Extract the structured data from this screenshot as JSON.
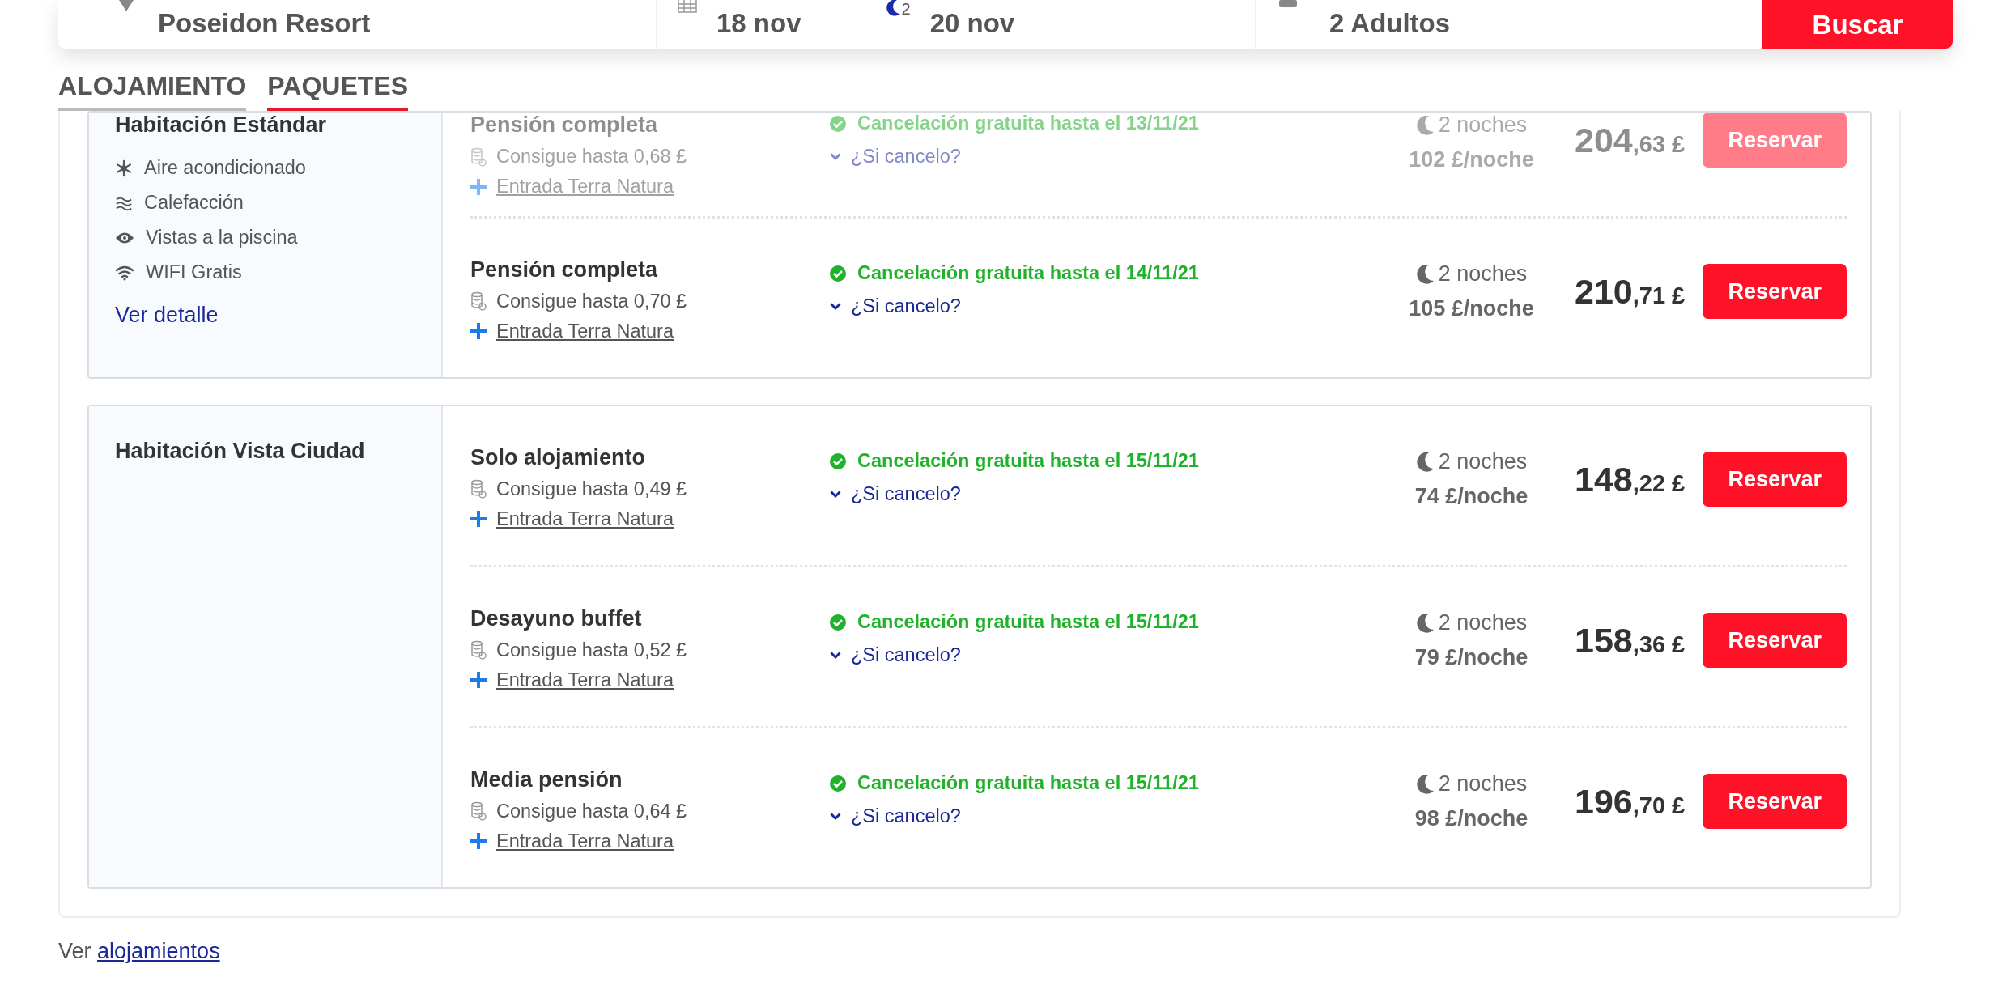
{
  "search": {
    "destination": "Poseidon Resort",
    "checkin": "18 nov",
    "nights": "2",
    "checkout": "20 nov",
    "guests": "2 Adultos",
    "button": "Buscar"
  },
  "tabs": [
    {
      "label": "ALOJAMIENTO",
      "selected": false
    },
    {
      "label": "PAQUETES",
      "selected": true
    }
  ],
  "rooms": [
    {
      "name": "Habitación Estándar",
      "amenities": [
        {
          "kind": "snowflake",
          "label": "Aire acondicionado"
        },
        {
          "kind": "waves",
          "label": "Calefacción"
        },
        {
          "kind": "eye",
          "label": "Vistas a la piscina"
        },
        {
          "kind": "wifi",
          "label": "WIFI Gratis"
        }
      ],
      "detail_link": "Ver detalle",
      "rates": [
        {
          "board": "Pensión completa",
          "points": "Consigue hasta 0,68 £",
          "extra": "Entrada Terra Natura",
          "cancellation": "Cancelación gratuita hasta el 13/11/21",
          "cancel_toggle": "¿Si cancelo?",
          "nights": "2 noches",
          "per_night": "102 £/noche",
          "price_int": "204",
          "price_dec": ",63 £",
          "button": "Reservar",
          "faded": true
        },
        {
          "board": "Pensión completa",
          "points": "Consigue hasta 0,70 £",
          "extra": "Entrada Terra Natura",
          "cancellation": "Cancelación gratuita hasta el 14/11/21",
          "cancel_toggle": "¿Si cancelo?",
          "nights": "2 noches",
          "per_night": "105 £/noche",
          "price_int": "210",
          "price_dec": ",71 £",
          "button": "Reservar",
          "faded": false
        }
      ]
    },
    {
      "name": "Habitación Vista Ciudad",
      "rates": [
        {
          "board": "Solo alojamiento",
          "points": "Consigue hasta 0,49 £",
          "extra": "Entrada Terra Natura",
          "cancellation": "Cancelación gratuita hasta el 15/11/21",
          "cancel_toggle": "¿Si cancelo?",
          "nights": "2 noches",
          "per_night": "74 £/noche",
          "price_int": "148",
          "price_dec": ",22 £",
          "button": "Reservar",
          "faded": false
        },
        {
          "board": "Desayuno buffet",
          "points": "Consigue hasta 0,52 £",
          "extra": "Entrada Terra Natura",
          "cancellation": "Cancelación gratuita hasta el 15/11/21",
          "cancel_toggle": "¿Si cancelo?",
          "nights": "2 noches",
          "per_night": "79 £/noche",
          "price_int": "158",
          "price_dec": ",36 £",
          "button": "Reservar",
          "faded": false
        },
        {
          "board": "Media pensión",
          "points": "Consigue hasta 0,64 £",
          "extra": "Entrada Terra Natura",
          "cancellation": "Cancelación gratuita hasta el 15/11/21",
          "cancel_toggle": "¿Si cancelo?",
          "nights": "2 noches",
          "per_night": "98 £/noche",
          "price_int": "196",
          "price_dec": ",70 £",
          "button": "Reservar",
          "faded": false
        }
      ]
    }
  ],
  "footer": {
    "prefix": "Ver",
    "link": "alojamientos"
  }
}
